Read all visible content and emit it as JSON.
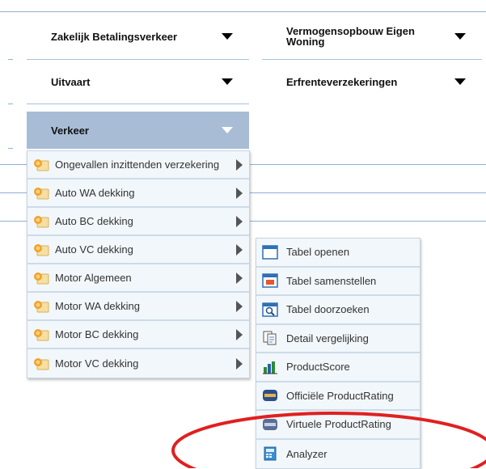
{
  "categories": [
    {
      "label": "Zakelijk Betalingsverkeer"
    },
    {
      "label": "Vermogensopbouw Eigen Woning"
    },
    {
      "label": "Uitvaart"
    },
    {
      "label": "Erfrenteverzekeringen"
    },
    {
      "label": "Verkeer"
    }
  ],
  "verkeer_menu": {
    "items": [
      {
        "label": "Ongevallen inzittenden verzekering"
      },
      {
        "label": "Auto WA dekking"
      },
      {
        "label": "Auto BC dekking"
      },
      {
        "label": "Auto VC dekking"
      },
      {
        "label": "Motor Algemeen"
      },
      {
        "label": "Motor WA dekking"
      },
      {
        "label": "Motor BC dekking"
      },
      {
        "label": "Motor VC dekking"
      }
    ]
  },
  "submenu": {
    "items": [
      {
        "label": "Tabel openen"
      },
      {
        "label": "Tabel samenstellen"
      },
      {
        "label": "Tabel doorzoeken"
      },
      {
        "label": "Detail vergelijking"
      },
      {
        "label": "ProductScore"
      },
      {
        "label": "Officiële ProductRating"
      },
      {
        "label": "Virtuele ProductRating"
      },
      {
        "label": "Analyzer"
      }
    ]
  },
  "colors": {
    "accent_active": "#a8bcd6",
    "highlight_ellipse": "#e02020"
  }
}
